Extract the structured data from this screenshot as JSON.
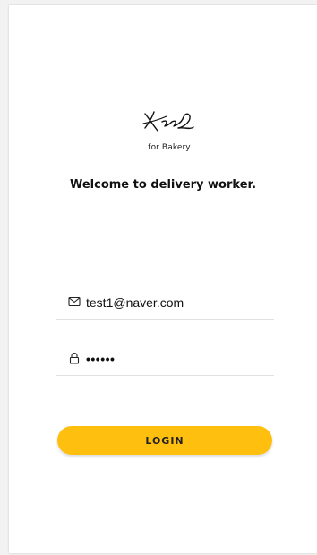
{
  "logo": {
    "icon": "signature-logo-icon",
    "subtitle": "for Bakery"
  },
  "welcome_text": "Welcome to delivery worker.",
  "email_field": {
    "icon": "mail-icon",
    "value": "test1@naver.com"
  },
  "password_field": {
    "icon": "lock-icon",
    "value": "••••••"
  },
  "login_button": {
    "label": "LOGIN",
    "color": "#ffbf0f"
  }
}
